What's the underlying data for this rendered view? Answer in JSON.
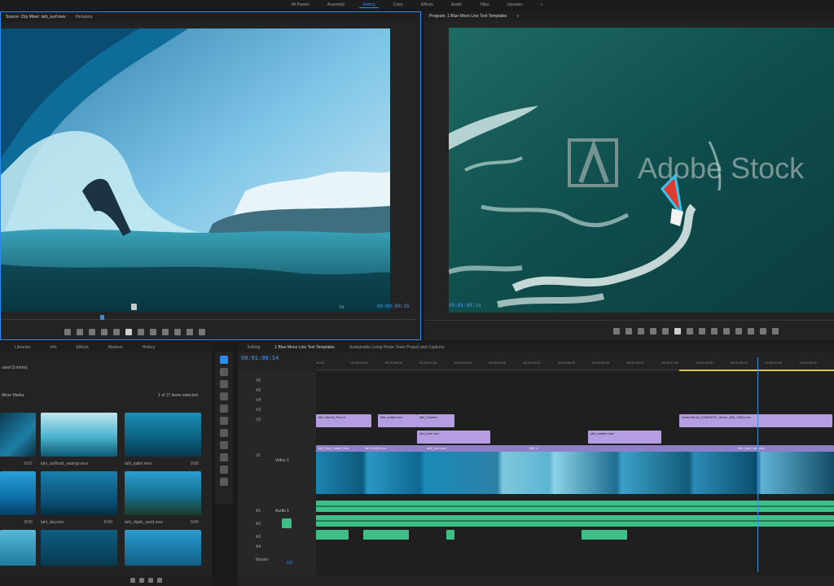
{
  "workspaces": [
    "All Panels",
    "Assembly",
    "Editing",
    "Color",
    "Effects",
    "Audio",
    "Titles",
    "Libraries"
  ],
  "active_workspace": "Editing",
  "source": {
    "tabs": [
      "Source: Clip Mixer: tahi_surf.mov",
      "Metadata"
    ],
    "timecode": "00:00:00:15",
    "fit": "Fit"
  },
  "program": {
    "title": "Program: 1 Blue Moon Line Text Templates",
    "timecode": "00:01:08:14",
    "fit": "Fit",
    "watermark": "Adobe Stock"
  },
  "project": {
    "tabs": [
      "Libraries",
      "Info",
      "Effects",
      "Markers",
      "History"
    ],
    "line1": "used (3 items)",
    "bin": "Mixer Media",
    "count": "1 of 17 items selected",
    "items": [
      {
        "name": "",
        "dur": "8:07"
      },
      {
        "name": "tahi_surfmail_watergr.mov",
        "dur": ""
      },
      {
        "name": "tahi_sailin.mov",
        "dur": "9:00"
      },
      {
        "name": "",
        "dur": "8:00"
      },
      {
        "name": "tahi_sky.mov",
        "dur": "8:00"
      },
      {
        "name": "tahi_digits_sand.mov",
        "dur": "9:00"
      }
    ]
  },
  "timeline": {
    "tabs": [
      "Editing",
      "1 Blue Moon Line Text Templates",
      "Sustainable Living Home Team Project and Captions"
    ],
    "timecode": "00:01:08:14",
    "ruler": [
      "00:00",
      "00:00:04:00",
      "00:00:08:00",
      "00:00:12:00",
      "00:00:16:00",
      "00:00:20:00",
      "00:00:24:00",
      "00:00:28:00",
      "00:00:32:00",
      "00:00:36:00",
      "00:00:40:00",
      "00:00:44:00",
      "00:00:48:00",
      "00:00:52:00",
      "00:00:56:00"
    ],
    "tracks": [
      "V6",
      "V5",
      "V4",
      "V3",
      "V2",
      "V1",
      "A1",
      "A2",
      "A3",
      "A4",
      "Master"
    ],
    "video_track_label": "Video 1",
    "audio_track_label": "Audio 1",
    "master_value": "0.0",
    "clips_v3": [
      "tahi_Blend_Roo.m",
      "tahi_water.mov",
      "tahi_Glueter",
      "AdobeStock_115963751_Aloha_360_1980.mov"
    ],
    "clips_v2": [
      "tahi_surf.mov",
      "tahi_waters.mov"
    ],
    "clips_v1": [
      "tahi_blue_water_mor",
      "tahi_whtfc.mov",
      "tahi_surf.mov",
      "tahi_b",
      "tahi_blue_wet.mov"
    ]
  },
  "colors": {
    "accent": "#2d8ceb",
    "clip_purple": "#b49de0",
    "audio_green": "#3dbf86",
    "playhead": "#3b8fd9",
    "work_area": "#d8c64a"
  }
}
